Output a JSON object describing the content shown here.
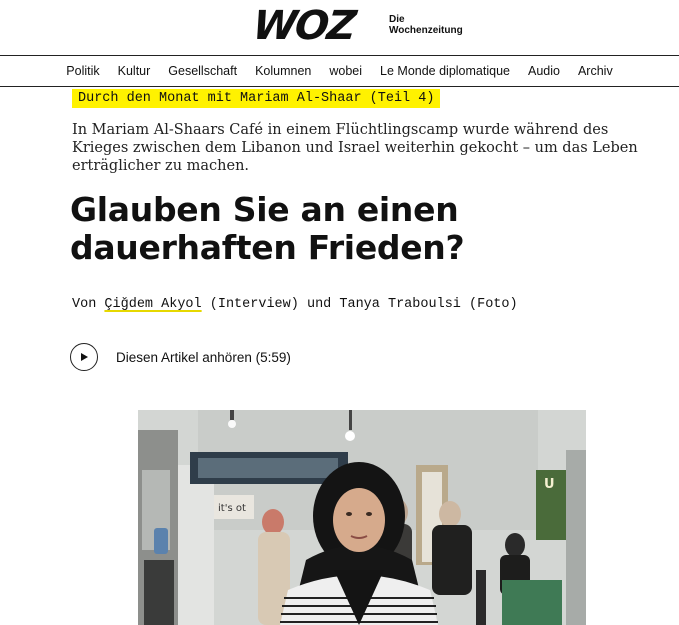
{
  "masthead": {
    "logo_text": "WOZ",
    "subtitle_line1": "Die",
    "subtitle_line2": "Wochenzeitung"
  },
  "nav": {
    "items": [
      "Politik",
      "Kultur",
      "Gesellschaft",
      "Kolumnen",
      "wobei",
      "Le Monde diplomatique",
      "Audio",
      "Archiv"
    ]
  },
  "article": {
    "kicker": "Durch den Monat mit Mariam Al-Shaar (Teil 4)",
    "lead": "In Mariam Al-Shaars Café in einem Flüchtlingscamp wurde während des Krieges zwischen dem Libanon und Israel weiterhin gekocht – um das Leben erträglicher zu machen.",
    "title": "Glauben Sie an einen dauerhaften Frieden?",
    "byline": {
      "prefix": "Von",
      "author": "Çiğdem Akyol",
      "role": "(Interview) und Tanya Traboulsi (Foto)"
    },
    "audio": {
      "label": "Diesen Artikel anhören (5:59)",
      "icon": "play-icon"
    },
    "photo": {
      "icon": "photo",
      "sign_text": "U"
    }
  },
  "colors": {
    "highlight": "#fff200",
    "text": "#111111"
  }
}
